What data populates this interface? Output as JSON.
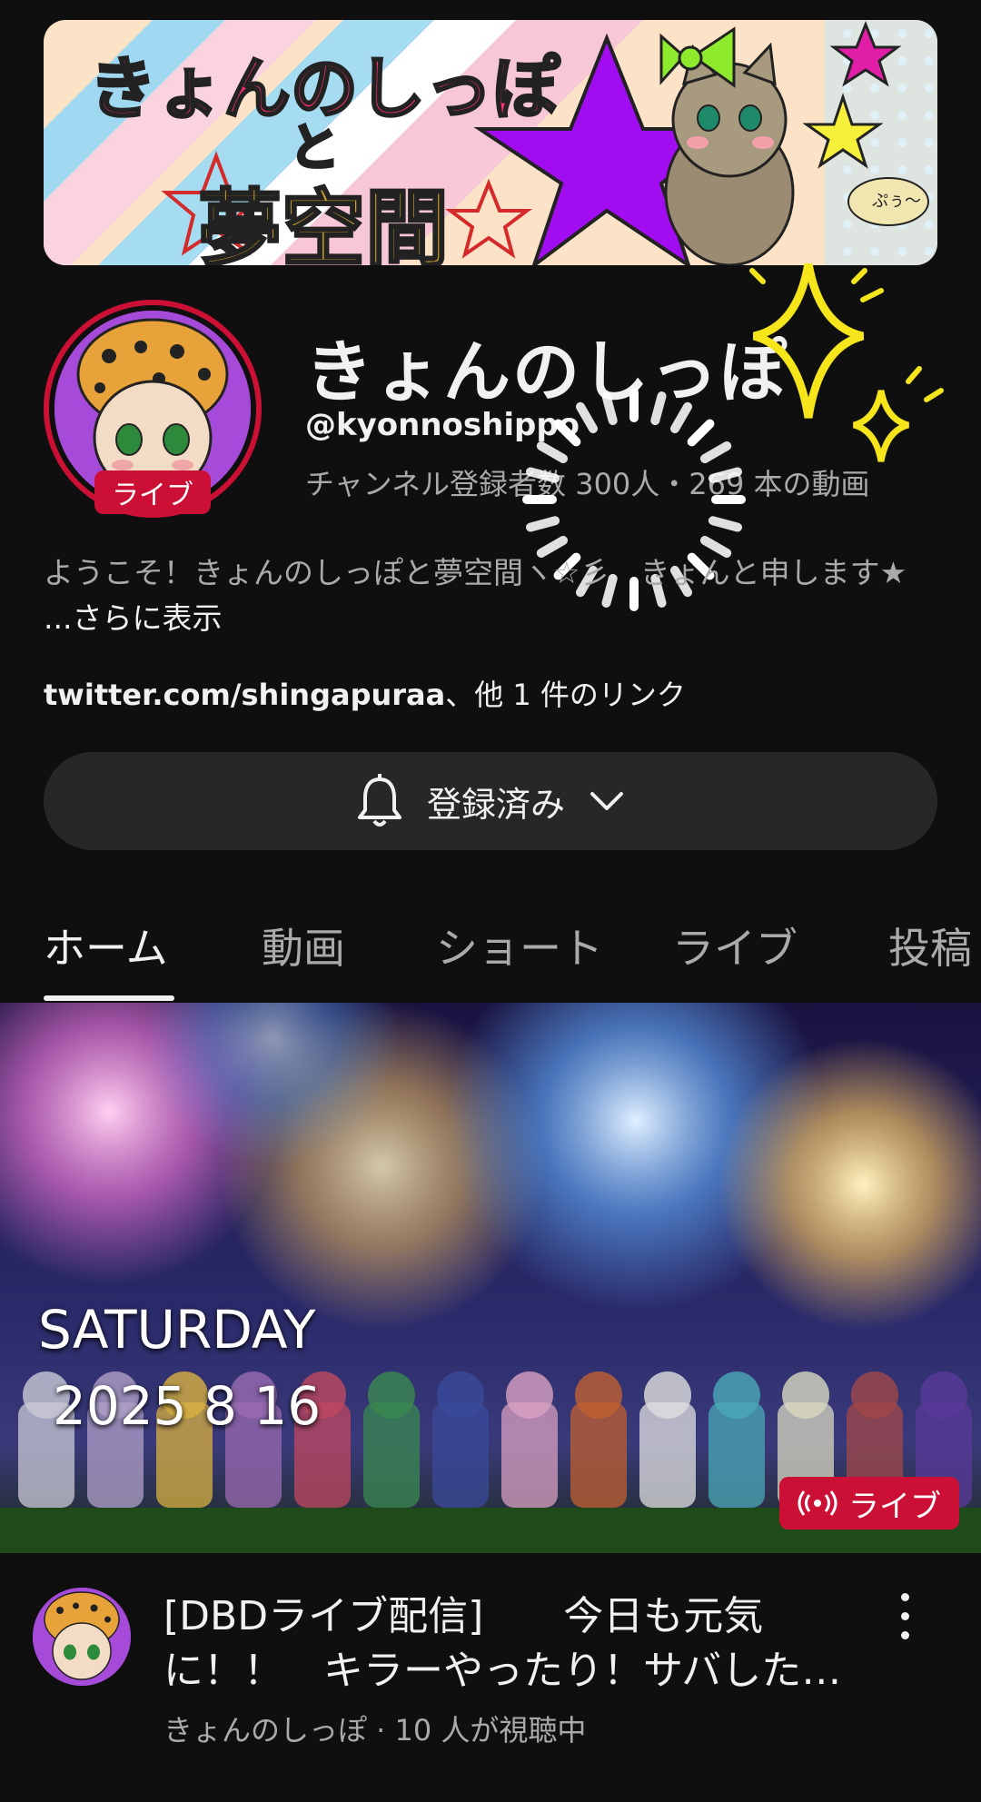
{
  "banner": {
    "title_line1": "きょんのしっぽ",
    "title_line2": "と",
    "title_line3": "夢空間",
    "sticker": "ぷぅ〜"
  },
  "channel": {
    "avatar_live_label": "ライブ",
    "name": "きょんのしっぽ",
    "handle": "@kyonnoshippo",
    "stats": "チャンネル登録者数 300人・269 本の動画",
    "description": "ようこそ！きょんのしっぽと夢空間ヽ☆彡　きょんと申します★ ",
    "description_more": "...さらに表示",
    "links_main": "twitter.com/shingapuraa",
    "links_rest": "、他 1 件のリンク"
  },
  "subscribe": {
    "label": "登録済み",
    "icon": "bell-icon"
  },
  "tabs": [
    {
      "label": "ホーム",
      "active": true
    },
    {
      "label": "動画",
      "active": false
    },
    {
      "label": "ショート",
      "active": false
    },
    {
      "label": "ライブ",
      "active": false
    },
    {
      "label": "投稿",
      "active": false
    }
  ],
  "video": {
    "thumb_line1": "SATURDAY",
    "thumb_line2": "2025 8 16",
    "live_badge": "ライブ",
    "title": "[DBDライブ配信]　　今日も元気に！！　キラーやったり！サバした…",
    "meta": "きょんのしっぽ · 10 人が視聴中"
  },
  "colors": {
    "background": "#0f0f0f",
    "live_red": "#cc0f35",
    "button_bg": "#272727",
    "secondary_text": "#aaaaaa"
  }
}
